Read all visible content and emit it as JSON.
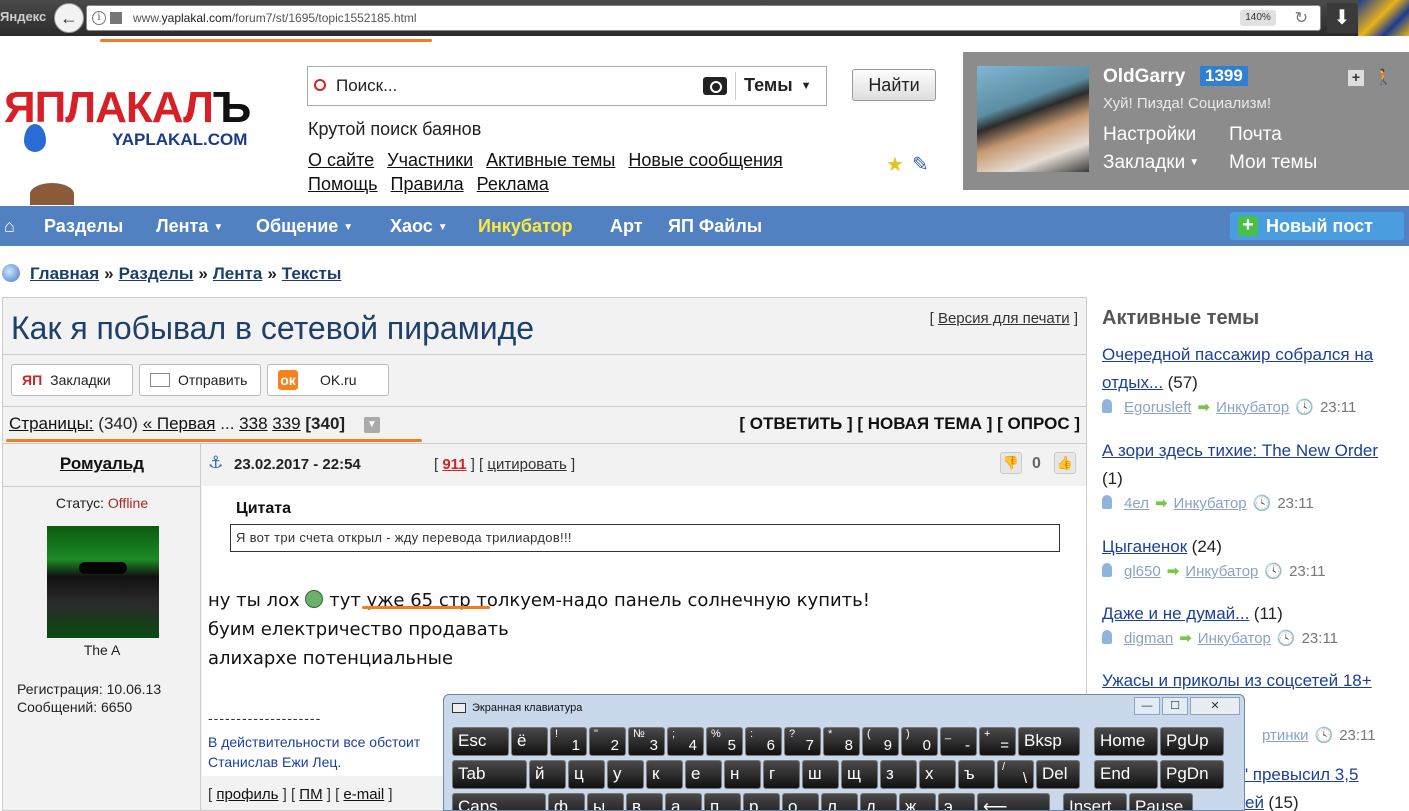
{
  "browser": {
    "brand": "Яндекс",
    "url_prefix": "www.",
    "url_host": "yaplakal.com",
    "url_path": "/forum7/st/1695/topic1552185.html",
    "zoom": "140%"
  },
  "header": {
    "logo_main_red": "ЯПЛАКАЛ",
    "logo_main_dark": "Ъ",
    "logo_sub": "YAPLAKAL.COM",
    "search_placeholder": "Поиск...",
    "search_scope": "Темы",
    "find_label": "Найти",
    "slogan": "Крутой поиск баянов",
    "links_row1": [
      "О сайте",
      "Участники",
      "Активные темы",
      "Новые сообщения"
    ],
    "links_row2": [
      "Помощь",
      "Правила",
      "Реклама"
    ]
  },
  "user": {
    "name": "OldGarry",
    "karma": "1399",
    "motto": "Хуй! Пизда! Социализм!",
    "links": [
      "Настройки",
      "Почта",
      "Закладки",
      "Мои темы"
    ]
  },
  "nav": {
    "items": [
      {
        "label": "Разделы",
        "dropdown": false
      },
      {
        "label": "Лента",
        "dropdown": true
      },
      {
        "label": "Общение",
        "dropdown": true
      },
      {
        "label": "Хаос",
        "dropdown": true
      },
      {
        "label": "Инкубатор",
        "dropdown": false
      },
      {
        "label": "Арт",
        "dropdown": false
      },
      {
        "label": "ЯП Файлы",
        "dropdown": false
      }
    ],
    "new_post": "Новый пост"
  },
  "breadcrumb": [
    "Главная",
    "Разделы",
    "Лента",
    "Тексты"
  ],
  "topic": {
    "title": "Как я побывал в сетевой пирамиде",
    "print_version": "Версия для печати",
    "share": [
      "Закладки",
      "Отправить",
      "OK.ru"
    ],
    "pager": {
      "label": "Страницы:",
      "total": "(340)",
      "first": "« Первая",
      "ellipsis": "...",
      "pages": [
        "338",
        "339"
      ],
      "current": "[340]"
    },
    "actions": [
      "[ ОТВЕТИТЬ ]",
      "[ НОВАЯ ТЕМА ]",
      "[ ОПРОС ]"
    ]
  },
  "post": {
    "author": "Ромуальд",
    "status_label": "Статус:",
    "status_value": "Offline",
    "avatar_caption": "The A",
    "registration": "Регистрация: 10.06.13",
    "messages": "Сообщений: 6650",
    "date": "23.02.2017 - 22:54",
    "number": "911",
    "quote_action": "цитировать",
    "votes": "0",
    "quote_title": "Цитата",
    "quote_text": "Я вот три счета открыл - жду перевода трилиардов!!!",
    "text_lines": [
      "ну ты лох",
      "тут уже 65 стр толкуем-надо панель солнечную купить!",
      "буим електричество продавать",
      "алихархе потенциальные"
    ],
    "signature_line": "--------------------",
    "signature_text": "В действительности все обстоит",
    "signature_author": "Станислав Ежи Лец.",
    "footer_links": [
      "профиль",
      "ПМ",
      "e-mail"
    ]
  },
  "sidebar": {
    "title": "Активные темы",
    "items": [
      {
        "title": "Очередной пассажир собрался на отдых...",
        "count": "(57)",
        "user": "Egorusleft",
        "section": "Инкубатор",
        "time": "23:11"
      },
      {
        "title": "А зори здесь тихие: The New Order",
        "count": "(1)",
        "user": "4ел",
        "section": "Инкубатор",
        "time": "23:11"
      },
      {
        "title": "Цыганенок",
        "count": "(24)",
        "user": "gl650",
        "section": "Инкубатор",
        "time": "23:11"
      },
      {
        "title": "Даже и не думай...",
        "count": "(11)",
        "user": "digman",
        "section": "Инкубатор",
        "time": "23:11"
      },
      {
        "title": "Ужасы и приколы из соцсетей 18+",
        "count": "",
        "user": "",
        "section": "ртинки",
        "time": "23:11"
      },
      {
        "title": "\" превысил 3,5",
        "count": "",
        "user": "",
        "section": "",
        "time": ""
      },
      {
        "title": "ей",
        "count": "(15)",
        "user": "",
        "section": "",
        "time": ""
      }
    ]
  },
  "keyboard": {
    "title": "Экранная клавиатура",
    "row1": [
      {
        "main": "Esc"
      },
      {
        "main": "ё"
      },
      {
        "top": "!",
        "bot": "1"
      },
      {
        "top": "\"",
        "bot": "2"
      },
      {
        "top": "№",
        "bot": "3"
      },
      {
        "top": ";",
        "bot": "4"
      },
      {
        "top": "%",
        "bot": "5"
      },
      {
        "top": ":",
        "bot": "6"
      },
      {
        "top": "?",
        "bot": "7"
      },
      {
        "top": "*",
        "bot": "8"
      },
      {
        "top": "(",
        "bot": "9"
      },
      {
        "top": ")",
        "bot": "0"
      },
      {
        "top": "_",
        "bot": "-"
      },
      {
        "top": "+",
        "bot": "="
      },
      {
        "main": "Bksp"
      },
      {
        "main": "Home"
      },
      {
        "main": "PgUp"
      }
    ],
    "row2": [
      {
        "main": "Tab"
      },
      {
        "main": "й"
      },
      {
        "main": "ц"
      },
      {
        "main": "у"
      },
      {
        "main": "к"
      },
      {
        "main": "е"
      },
      {
        "main": "н"
      },
      {
        "main": "г"
      },
      {
        "main": "ш"
      },
      {
        "main": "щ"
      },
      {
        "main": "з"
      },
      {
        "main": "х"
      },
      {
        "main": "ъ"
      },
      {
        "top": "/",
        "bot": "\\"
      },
      {
        "main": "Del"
      },
      {
        "main": "End"
      },
      {
        "main": "PgDn"
      }
    ],
    "row3": [
      {
        "main": "Caps"
      },
      {
        "main": "ф"
      },
      {
        "main": "ы"
      },
      {
        "main": "в"
      },
      {
        "main": "а"
      },
      {
        "main": "п"
      },
      {
        "main": "р"
      },
      {
        "main": "о"
      },
      {
        "main": "л"
      },
      {
        "main": "д"
      },
      {
        "main": "ж"
      },
      {
        "main": "э"
      },
      {
        "main": "⟵"
      },
      {
        "main": "Insert"
      },
      {
        "main": "Pause"
      }
    ]
  }
}
